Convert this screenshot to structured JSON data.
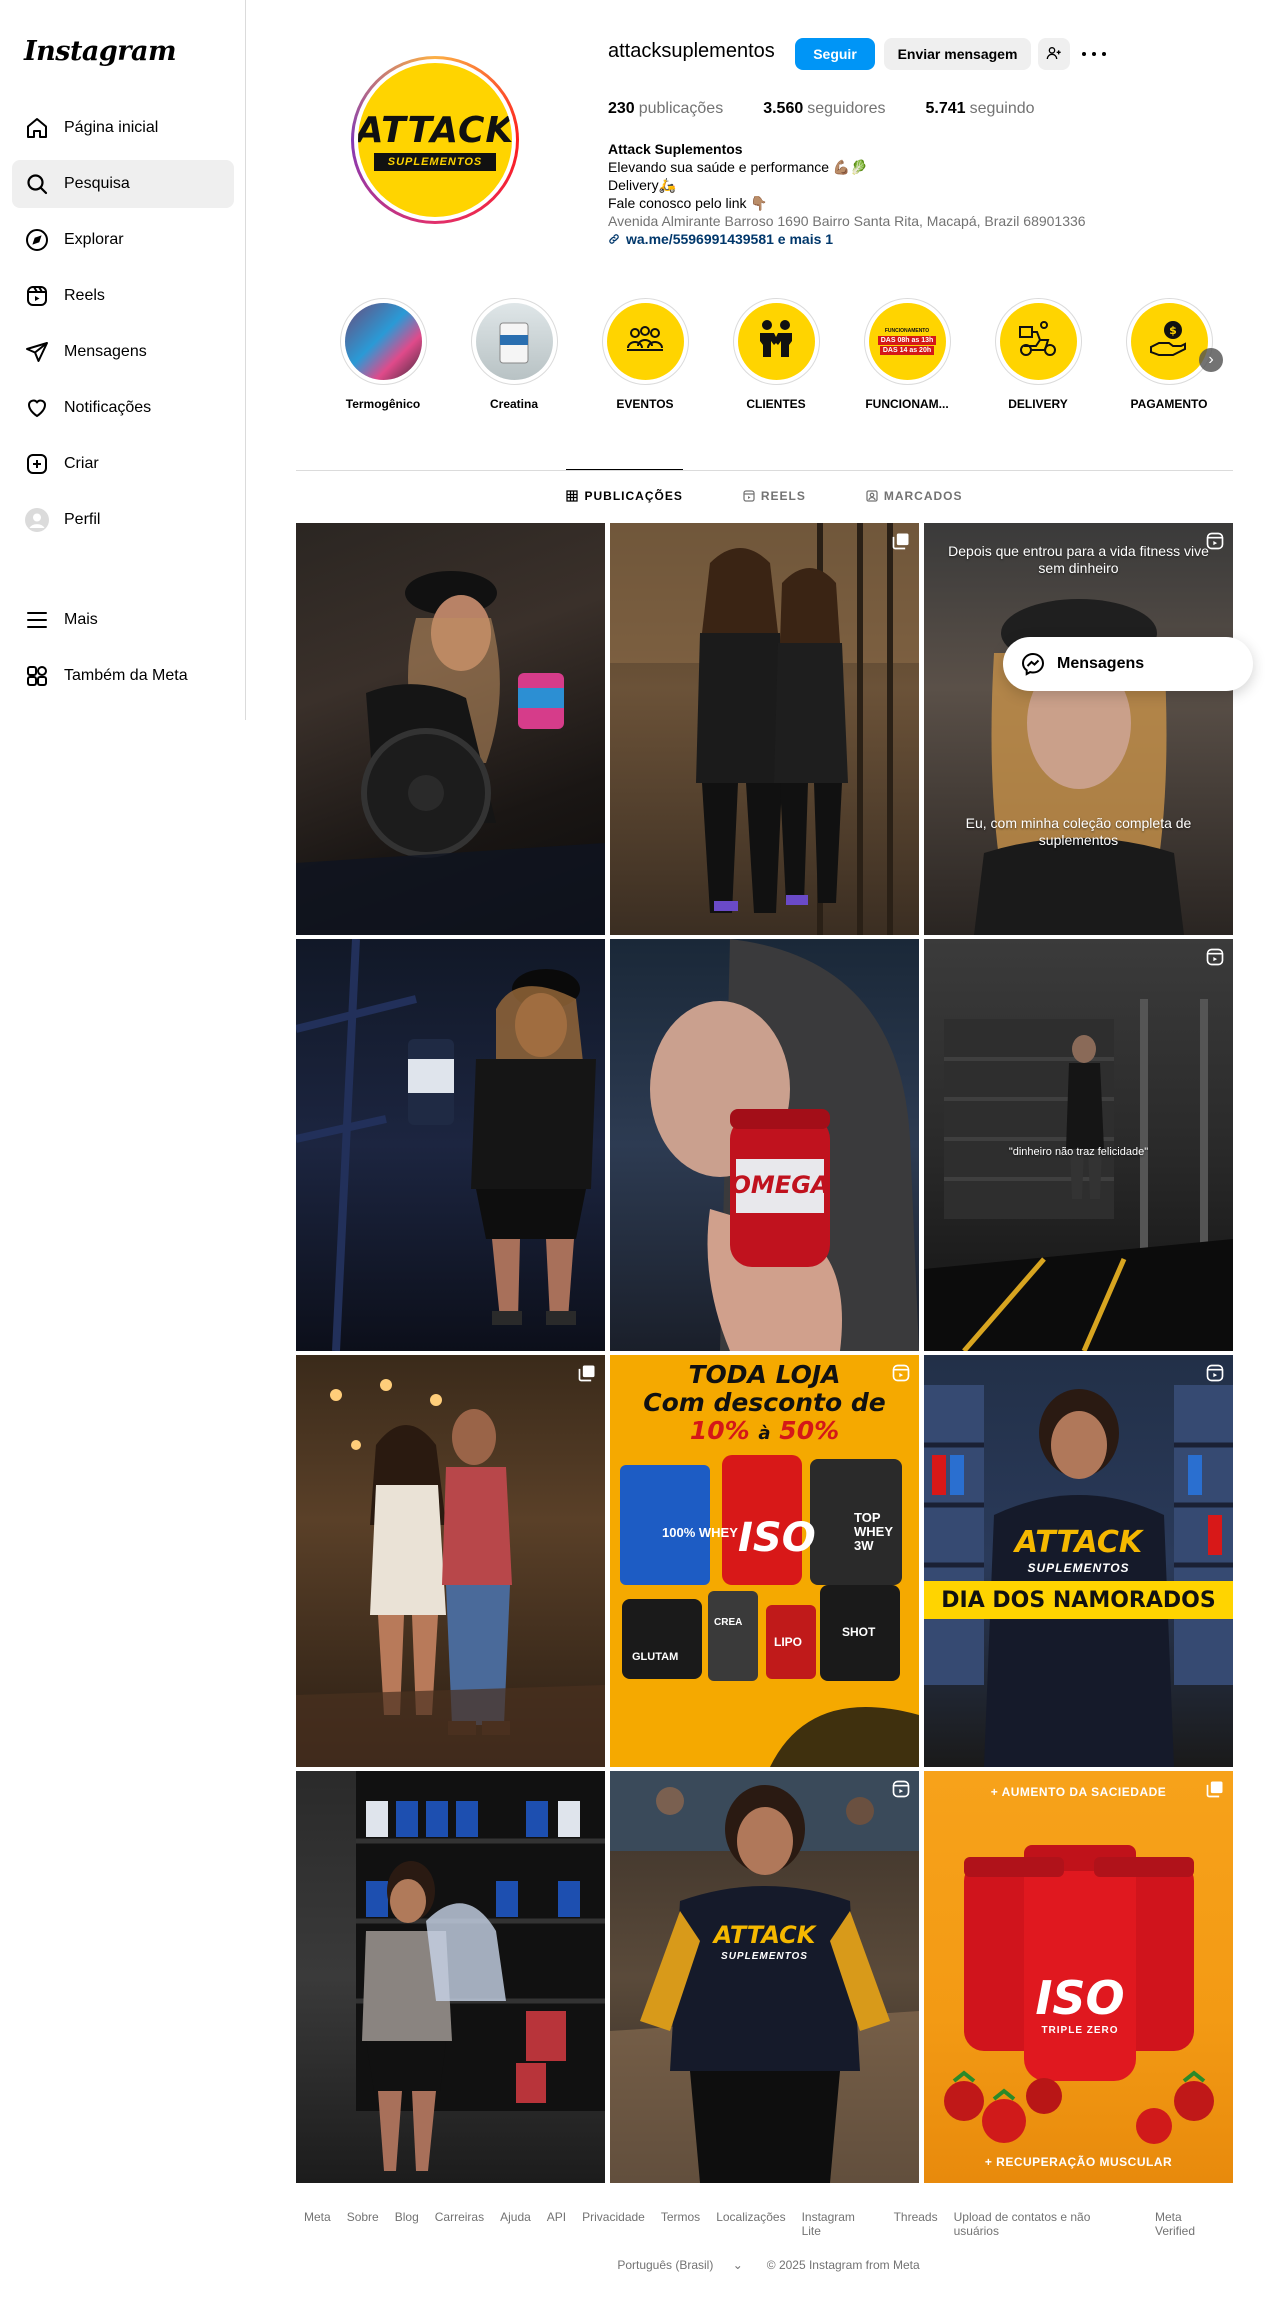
{
  "app": {
    "logo": "Instagram"
  },
  "sidebar": {
    "items": [
      {
        "label": "Página inicial",
        "icon": "home-icon"
      },
      {
        "label": "Pesquisa",
        "icon": "search-icon"
      },
      {
        "label": "Explorar",
        "icon": "compass-icon"
      },
      {
        "label": "Reels",
        "icon": "reels-icon"
      },
      {
        "label": "Mensagens",
        "icon": "send-icon"
      },
      {
        "label": "Notificações",
        "icon": "heart-icon"
      },
      {
        "label": "Criar",
        "icon": "plus-square-icon"
      },
      {
        "label": "Perfil",
        "icon": "profile-avatar"
      }
    ],
    "bottom": [
      {
        "label": "Mais",
        "icon": "menu-icon"
      },
      {
        "label": "Também da Meta",
        "icon": "meta-apps-icon"
      }
    ]
  },
  "profile": {
    "username": "attacksuplementos",
    "follow_label": "Seguir",
    "message_label": "Enviar mensagem",
    "avatar_text": {
      "line1": "ATTACK",
      "line2": "SUPLEMENTOS"
    },
    "stats": {
      "posts": {
        "value": "230",
        "label": "publicações"
      },
      "followers": {
        "value": "3.560",
        "label": "seguidores"
      },
      "following": {
        "value": "5.741",
        "label": "seguindo"
      }
    },
    "bio": {
      "name": "Attack Suplementos",
      "line1": "Elevando sua saúde e performance 💪🏽🥬",
      "line2": "Delivery🛵",
      "line3": "Fale conosco pelo link 👇🏽",
      "address": "Avenida Almirante Barroso 1690 Bairro Santa Rita, Macapá, Brazil 68901336",
      "link": "wa.me/5596991439581 e mais 1"
    }
  },
  "highlights": [
    {
      "label": "Termogênico",
      "icon": "product-thumb"
    },
    {
      "label": "Creatina",
      "icon": "product-thumb"
    },
    {
      "label": "EVENTOS",
      "icon": "people-icon"
    },
    {
      "label": "CLIENTES",
      "icon": "handshake-icon"
    },
    {
      "label": "FUNCIONAM...",
      "icon": "hours-sign",
      "sign_lines": [
        "FUNCIONAMENTO",
        "DAS 08h as 13h",
        "DAS 14 as 20h"
      ]
    },
    {
      "label": "DELIVERY",
      "icon": "delivery-icon"
    },
    {
      "label": "PAGAMENTO",
      "icon": "payment-icon"
    }
  ],
  "tabs": [
    {
      "label": "PUBLICAÇÕES",
      "icon": "grid-icon",
      "active": true
    },
    {
      "label": "REELS",
      "icon": "reels-icon",
      "active": false
    },
    {
      "label": "MARCADOS",
      "icon": "tagged-icon",
      "active": false
    }
  ],
  "posts": {
    "p3_top": "Depois que entrou para a vida fitness vive sem dinheiro",
    "p3_bottom": "Eu, com minha coleção completa de suplementos",
    "p6_text": "\"dinheiro não traz felicidade\"",
    "p8_title1": "TODA LOJA",
    "p8_title2": "Com desconto de",
    "p8_title3a": "10%",
    "p8_title3b": "à",
    "p8_title3c": "50%",
    "p8_products": [
      "100% WHEY",
      "ISO",
      "TOP WHEY 3W",
      "GLUTAM",
      "CREA",
      "LIPO",
      "SHOT"
    ],
    "p9_brand1": "ATTACK",
    "p9_brand2": "SUPLEMENTOS",
    "p9_banner": "DIA DOS NAMORADOS",
    "p11_brand1": "ATTACK",
    "p11_brand2": "SUPLEMENTOS",
    "p12_top": "+ AUMENTO DA SACIEDADE",
    "p12_bottom": "+ RECUPERAÇÃO MUSCULAR",
    "p12_product": "ISO",
    "p12_sub": "TRIPLE ZERO"
  },
  "popup": {
    "label": "Mensagens"
  },
  "footer": {
    "links": [
      "Meta",
      "Sobre",
      "Blog",
      "Carreiras",
      "Ajuda",
      "API",
      "Privacidade",
      "Termos",
      "Localizações",
      "Instagram Lite",
      "Threads",
      "Upload de contatos e não usuários",
      "Meta Verified"
    ],
    "language": "Português (Brasil)",
    "copyright": "© 2025 Instagram from Meta"
  },
  "colors": {
    "accent": "#0095f6",
    "brand_yellow": "#ffd400",
    "muted": "#737373",
    "border": "#dbdbdb"
  }
}
